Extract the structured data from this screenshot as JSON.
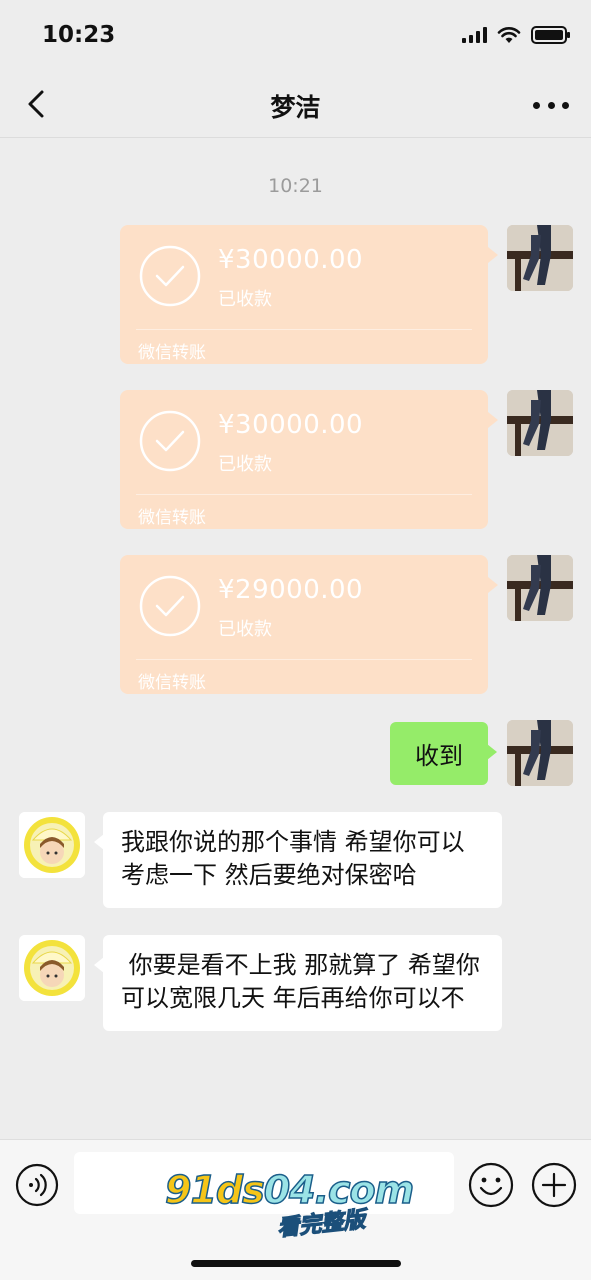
{
  "status_bar": {
    "time": "10:23"
  },
  "nav": {
    "title": "梦洁"
  },
  "chat": {
    "timestamp": "10:21",
    "transfers": [
      {
        "amount": "¥30000.00",
        "status": "已收款",
        "footer": "微信转账"
      },
      {
        "amount": "¥30000.00",
        "status": "已收款",
        "footer": "微信转账"
      },
      {
        "amount": "¥29000.00",
        "status": "已收款",
        "footer": "微信转账"
      }
    ],
    "sent_text": "收到",
    "received": [
      "我跟你说的那个事情 希望你可以考虑一下 然后要绝对保密哈",
      " 你要是看不上我 那就算了 希望你可以宽限几天 年后再给你可以不"
    ]
  },
  "watermark": {
    "main_prefix": "91ds",
    "main_suffix": "04.com",
    "sub": "看完整版"
  },
  "colors": {
    "background": "#ededed",
    "transfer_bg": "#fde0c8",
    "sent_bubble": "#95ec69"
  }
}
